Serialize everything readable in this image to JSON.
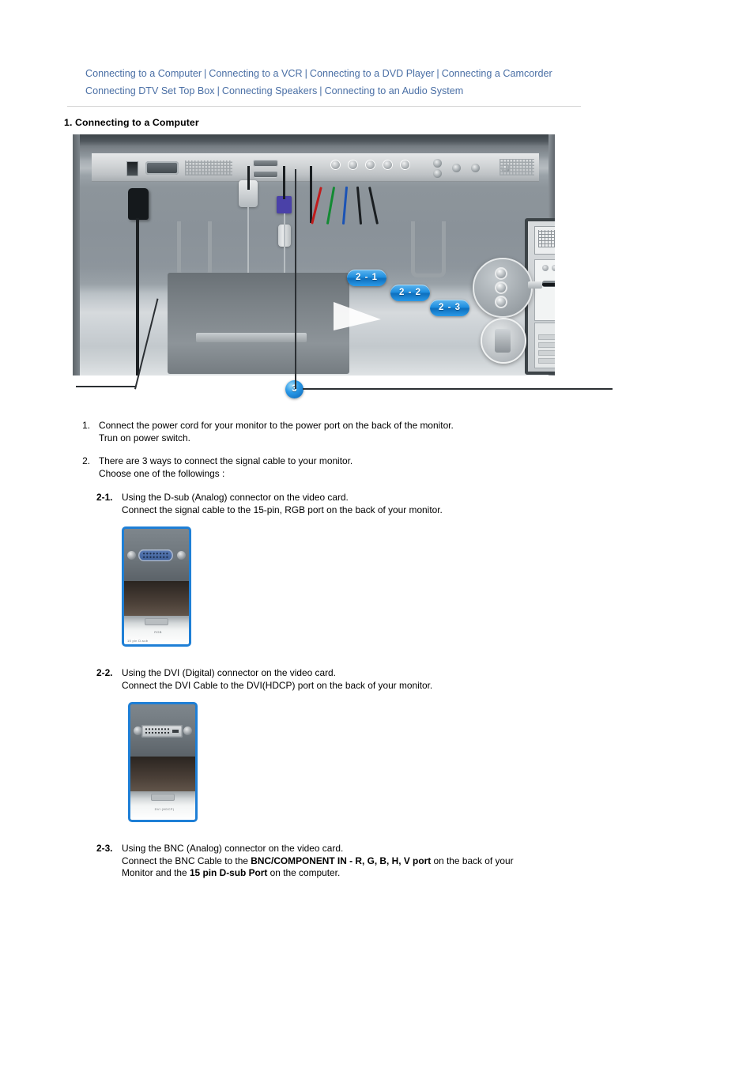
{
  "nav": {
    "separator": "|",
    "line1": [
      {
        "label": "Connecting to a Computer"
      },
      {
        "label": "Connecting to a VCR"
      },
      {
        "label": "Connecting to a DVD Player"
      },
      {
        "label": "Connecting a Camcorder"
      }
    ],
    "line2": [
      {
        "label": "Connecting DTV Set Top Box"
      },
      {
        "label": "Connecting Speakers"
      },
      {
        "label": "Connecting to an Audio System"
      }
    ],
    "link_color": "#4a6fa5"
  },
  "section": {
    "heading": "1. Connecting to a Computer"
  },
  "diagram": {
    "badges": {
      "b21": "2 - 1",
      "b22": "2 - 2",
      "b23": "2 - 3",
      "b3": "3"
    },
    "badge_color": "#1f8fe0"
  },
  "steps": [
    {
      "num": "1.",
      "lines": [
        "Connect the power cord for your monitor to the power port on the back of the monitor.",
        "Trun on power switch."
      ]
    },
    {
      "num": "2.",
      "lines": [
        "There are 3 ways to connect the signal cable to your monitor.",
        "Choose one of the followings :"
      ]
    }
  ],
  "substeps": [
    {
      "num": "2-1.",
      "line1": "Using the D-sub (Analog) connector on the video card.",
      "line2": "Connect the signal cable to the 15-pin, RGB port on the back of your monitor.",
      "thumb_caption_1": "RGB",
      "thumb_caption_2": "15 pin  D-sub",
      "thumb_port": "vga"
    },
    {
      "num": "2-2.",
      "line1": "Using the DVI (Digital) connector on the video card.",
      "line2": "Connect the DVI Cable to the DVI(HDCP) port on the back of your monitor.",
      "thumb_caption_1": "DVI (HDCP)",
      "thumb_caption_2": "",
      "thumb_port": "dvi"
    },
    {
      "num": "2-3.",
      "line1": "Using the BNC (Analog) connector on the video card.",
      "line2_a": "Connect the BNC Cable to the ",
      "line2_b": "BNC/COMPONENT IN - R, G, B, H, V port",
      "line2_c": " on the back of your",
      "line3_a": "Monitor and the ",
      "line3_b": "15 pin D-sub Port",
      "line3_c": " on the computer."
    }
  ]
}
